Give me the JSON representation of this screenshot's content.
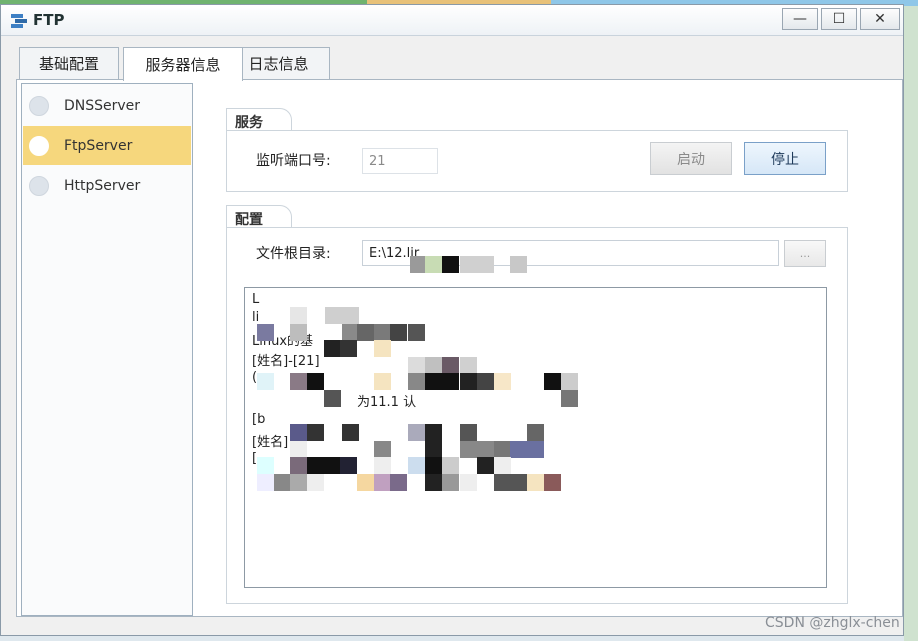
{
  "window": {
    "title": "FTP"
  },
  "tabs": [
    {
      "label": "基础配置"
    },
    {
      "label": "服务器信息"
    },
    {
      "label": "日志信息"
    }
  ],
  "servers": [
    {
      "label": "DNSServer",
      "selected": false
    },
    {
      "label": "FtpServer",
      "selected": true
    },
    {
      "label": "HttpServer",
      "selected": false
    }
  ],
  "service": {
    "title": "服务",
    "port_label": "监听端口号:",
    "port_value": "21",
    "start_label": "启动",
    "stop_label": "停止"
  },
  "config": {
    "title": "配置",
    "root_label": "文件根目录:",
    "root_value": "E:\\12.lir",
    "browse_label": "...",
    "log_lines": [
      "L",
      "li",
      "Linux的基",
      "[姓名]-[21]",
      "(",
      "为11.1 认",
      "[b",
      "[姓名]",
      "["
    ]
  },
  "watermark": "CSDN @zhglx-chen",
  "colors": {
    "selected_bg": "#f6d77d",
    "stop_button_bg": "#d6e7f7"
  }
}
